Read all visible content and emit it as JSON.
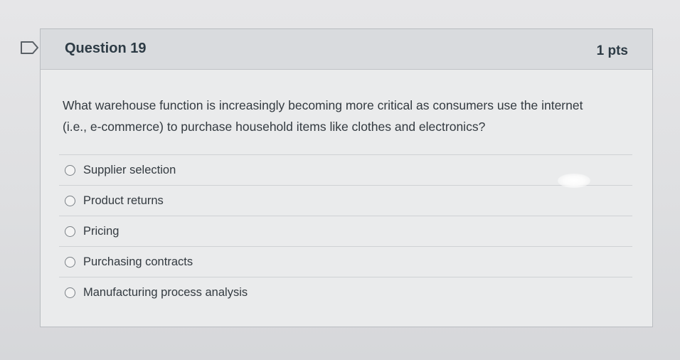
{
  "question": {
    "title": "Question 19",
    "points": "1 pts",
    "text": "What warehouse function is increasingly becoming more critical as consumers use the internet (i.e., e-commerce) to purchase household items like clothes and electronics?",
    "flag_icon": "flag-outline-icon"
  },
  "answers": [
    {
      "label": "Supplier selection",
      "selected": false
    },
    {
      "label": "Product returns",
      "selected": false
    },
    {
      "label": "Pricing",
      "selected": false
    },
    {
      "label": "Purchasing contracts",
      "selected": false
    },
    {
      "label": "Manufacturing process analysis",
      "selected": false
    }
  ],
  "colors": {
    "text": "#2d3b45",
    "header_bg": "#d9dbde",
    "card_bg": "#eaebec",
    "border": "#b9bcc0"
  }
}
